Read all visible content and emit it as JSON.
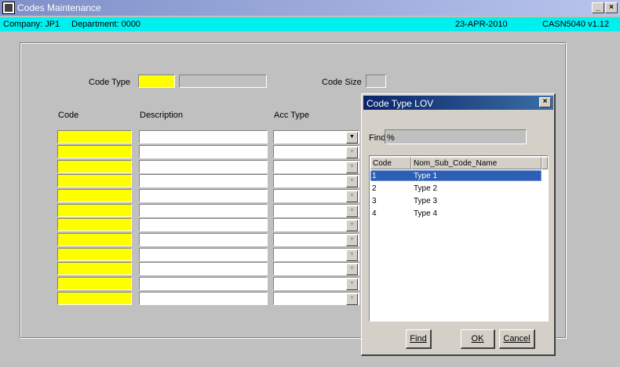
{
  "window": {
    "title": "Codes Maintenance",
    "minimize": "_",
    "close": "×"
  },
  "info": {
    "company": "Company: JP1",
    "department": "Department: 0000",
    "date": "23-APR-2010",
    "version": "CASN5040  v1.12"
  },
  "form": {
    "code_type_label": "Code Type",
    "code_size_label": "Code Size",
    "col_code": "Code",
    "col_description": "Description",
    "col_acc_type": "Acc Type"
  },
  "dialog": {
    "title": "Code Type LOV",
    "close": "×",
    "find_label": "Find",
    "find_value": "%",
    "columns": [
      "Code",
      "Nom_Sub_Code_Name"
    ],
    "rows": [
      {
        "code": "1",
        "name": "Type 1",
        "selected": true
      },
      {
        "code": "2",
        "name": "Type 2",
        "selected": false
      },
      {
        "code": "3",
        "name": "Type 3",
        "selected": false
      },
      {
        "code": "4",
        "name": "Type 4",
        "selected": false
      }
    ],
    "buttons": {
      "find": "Find",
      "ok": "OK",
      "cancel": "Cancel"
    }
  },
  "colors": {
    "required_field": "#ffff00",
    "info_bar": "#00f0f0",
    "selection": "#2d5fb4"
  }
}
